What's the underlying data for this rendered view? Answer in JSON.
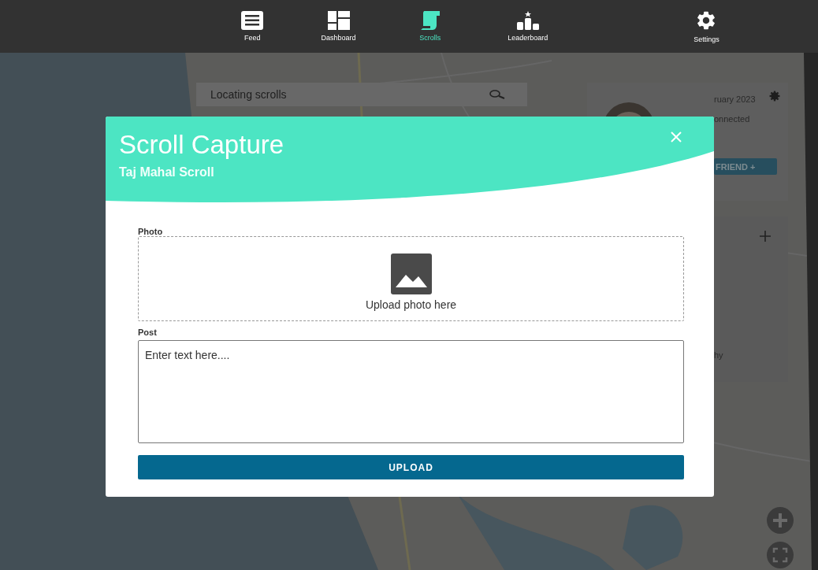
{
  "nav": {
    "items": [
      {
        "label": "Feed",
        "kind": "feed",
        "selected": false
      },
      {
        "label": "Dashboard",
        "kind": "dashboard",
        "selected": false
      },
      {
        "label": "Scrolls",
        "kind": "scroll",
        "selected": true
      },
      {
        "label": "Leaderboard",
        "kind": "podium",
        "selected": false
      },
      {
        "label": "Settings",
        "kind": "gear",
        "selected": false
      }
    ]
  },
  "search": {
    "placeholder": "Locating scrolls"
  },
  "profile_card": {
    "date": "ruary 2023",
    "status": "onnected",
    "button": "FRIEND +"
  },
  "side_card": {
    "text": "hy"
  },
  "modal": {
    "title": "Scroll Capture",
    "subtitle": "Taj Mahal Scroll",
    "photo_label": "Photo",
    "photo_hint": "Upload photo here",
    "post_label": "Post",
    "post_placeholder": "Enter text here....",
    "button": "UPLOAD"
  }
}
